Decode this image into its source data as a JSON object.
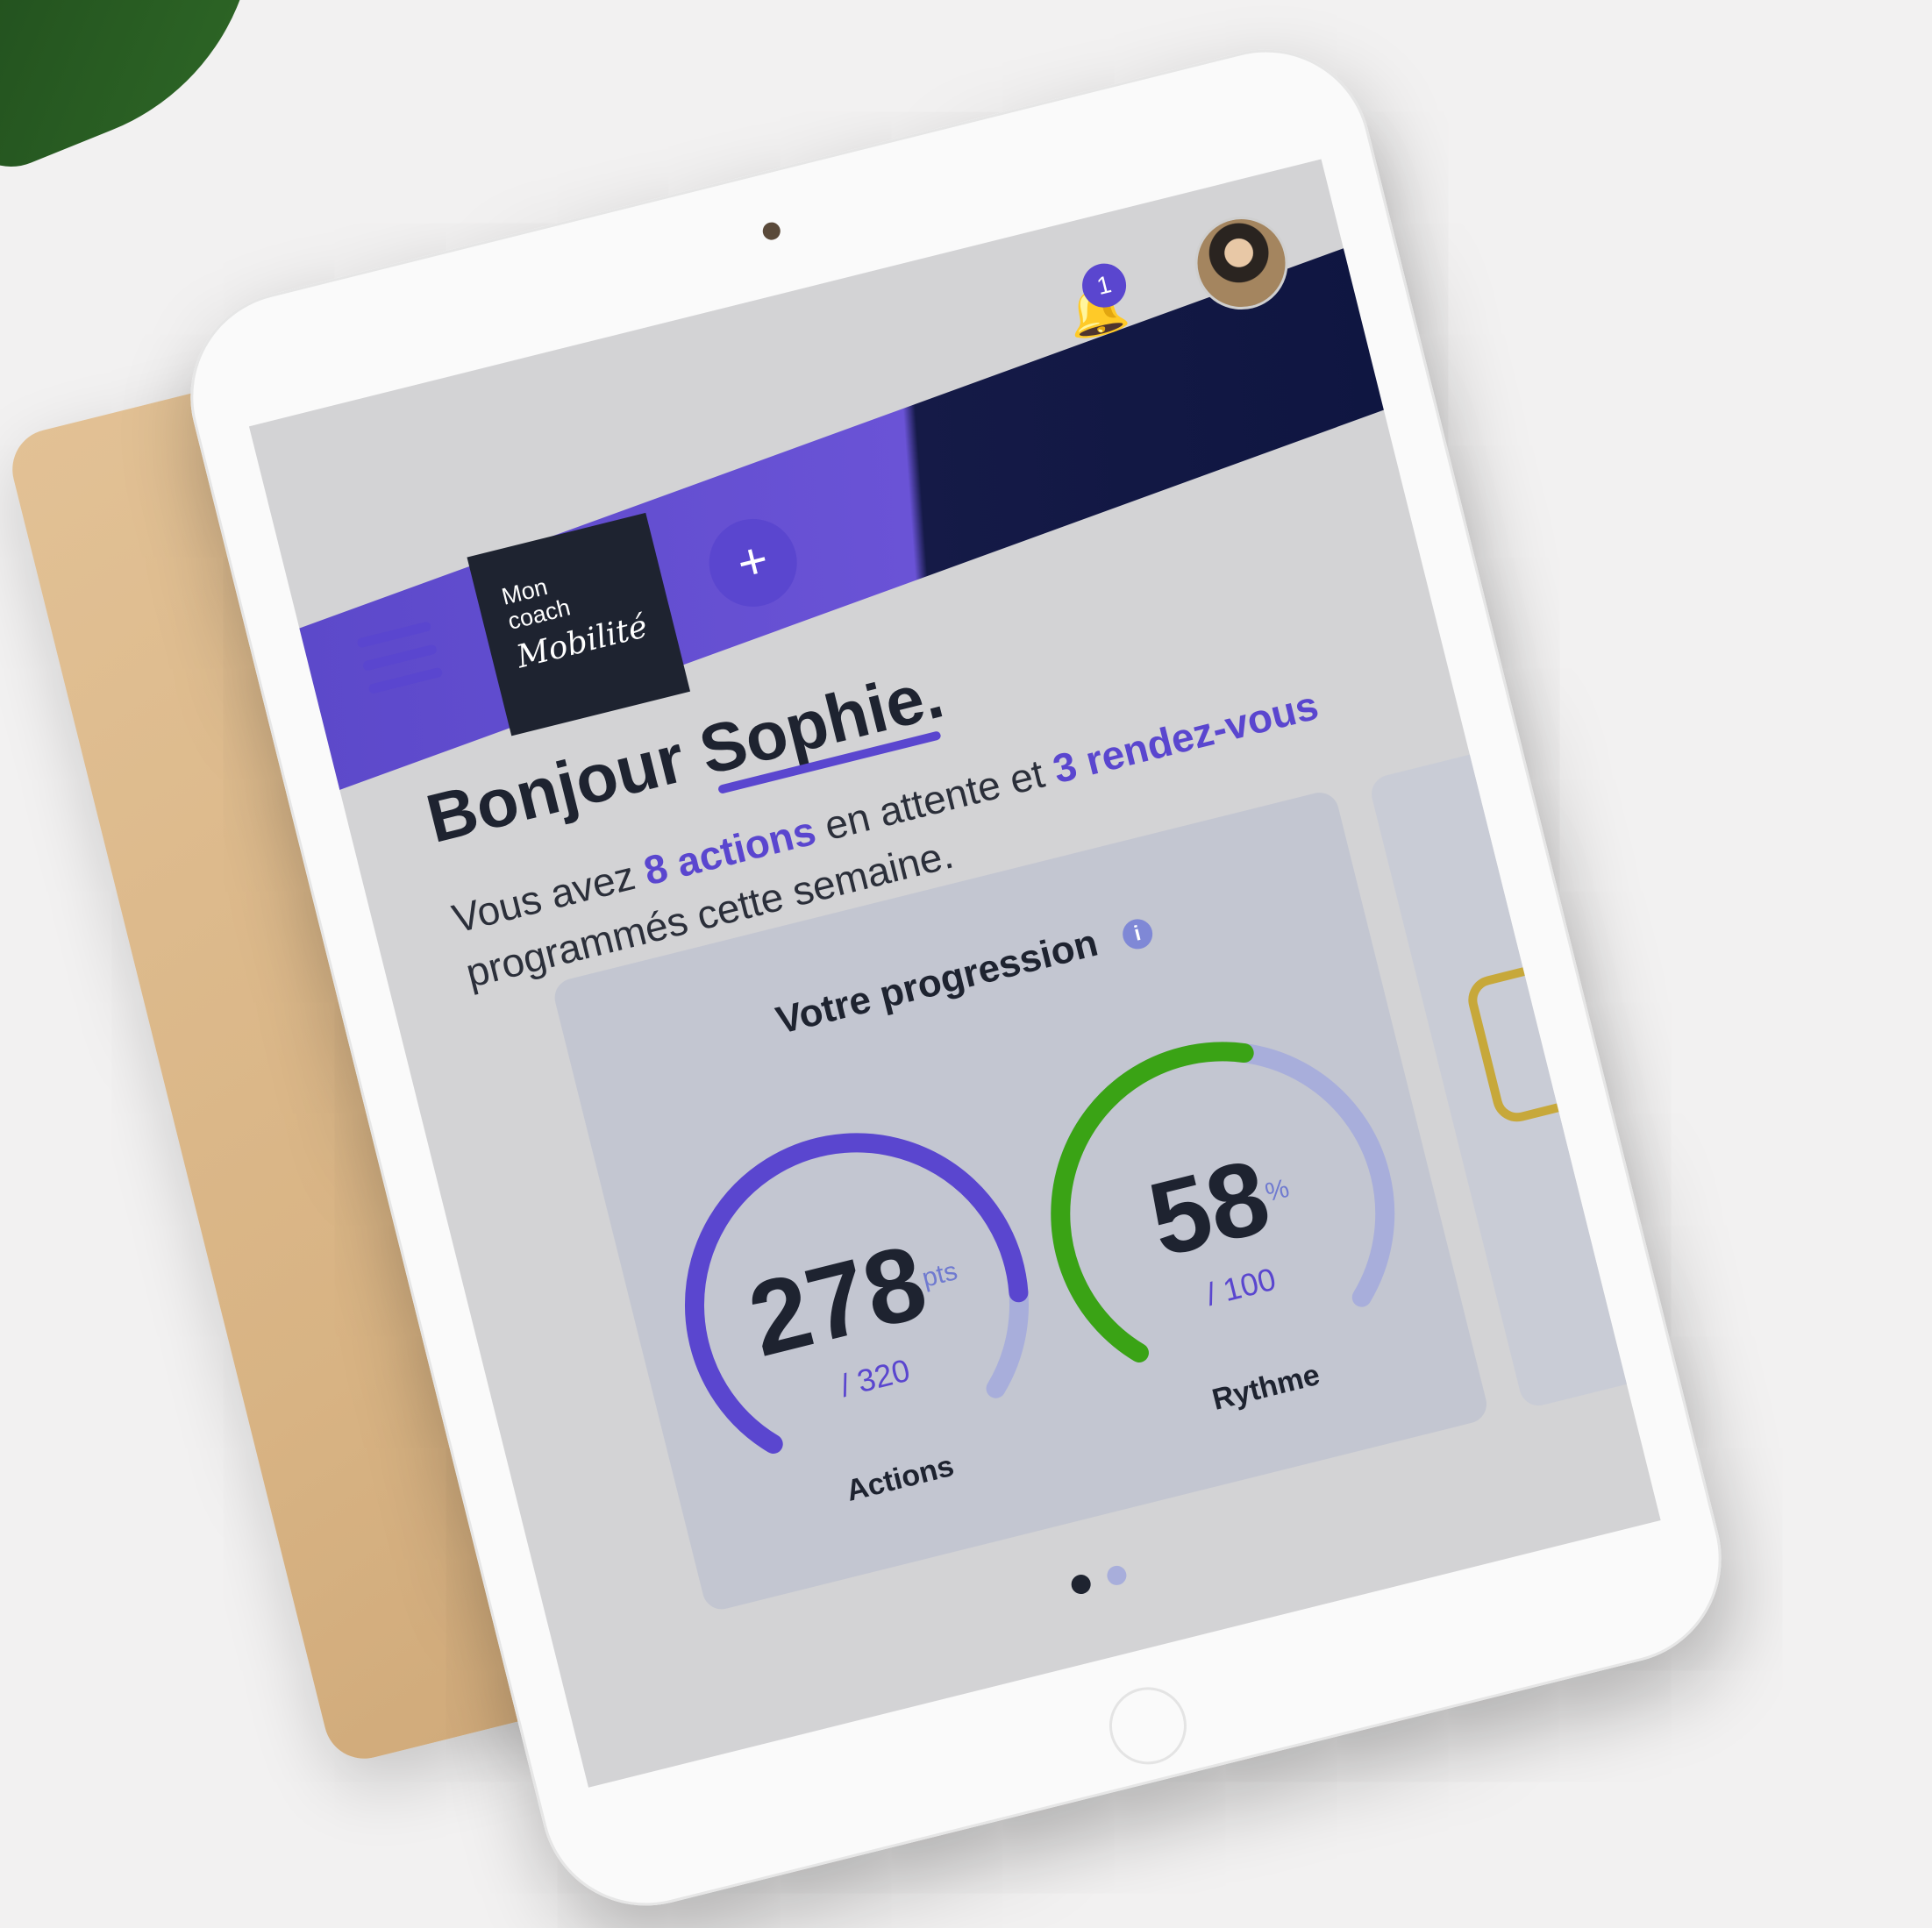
{
  "header": {
    "logo": {
      "line1": "Mon",
      "line2": "coach",
      "line3": "Mobilité"
    },
    "add_label": "+",
    "notifications_count": "1"
  },
  "greeting": {
    "hello": "Bonjour",
    "name": "Sophie."
  },
  "summary": {
    "prefix": "Vous avez",
    "actions": "8 actions",
    "middle": "en attente et",
    "appointments": "3 rendez-vous",
    "suffix": "programmés cette semaine."
  },
  "progress": {
    "title": "Votre progression",
    "info_icon": "i",
    "actions_gauge": {
      "value": "278",
      "unit": "pts",
      "total": "/ 320",
      "label": "Actions",
      "fraction": 0.869,
      "color": "#5a46cf",
      "track": "#a8aedb"
    },
    "rythme_gauge": {
      "value": "58",
      "unit": "%",
      "total": "/ 100",
      "label": "Rythme",
      "fraction": 0.58,
      "color": "#3aa315",
      "track": "#a8aedb"
    }
  },
  "pager": {
    "active_color": "#1e2330",
    "inactive_color": "#a8aedb"
  }
}
